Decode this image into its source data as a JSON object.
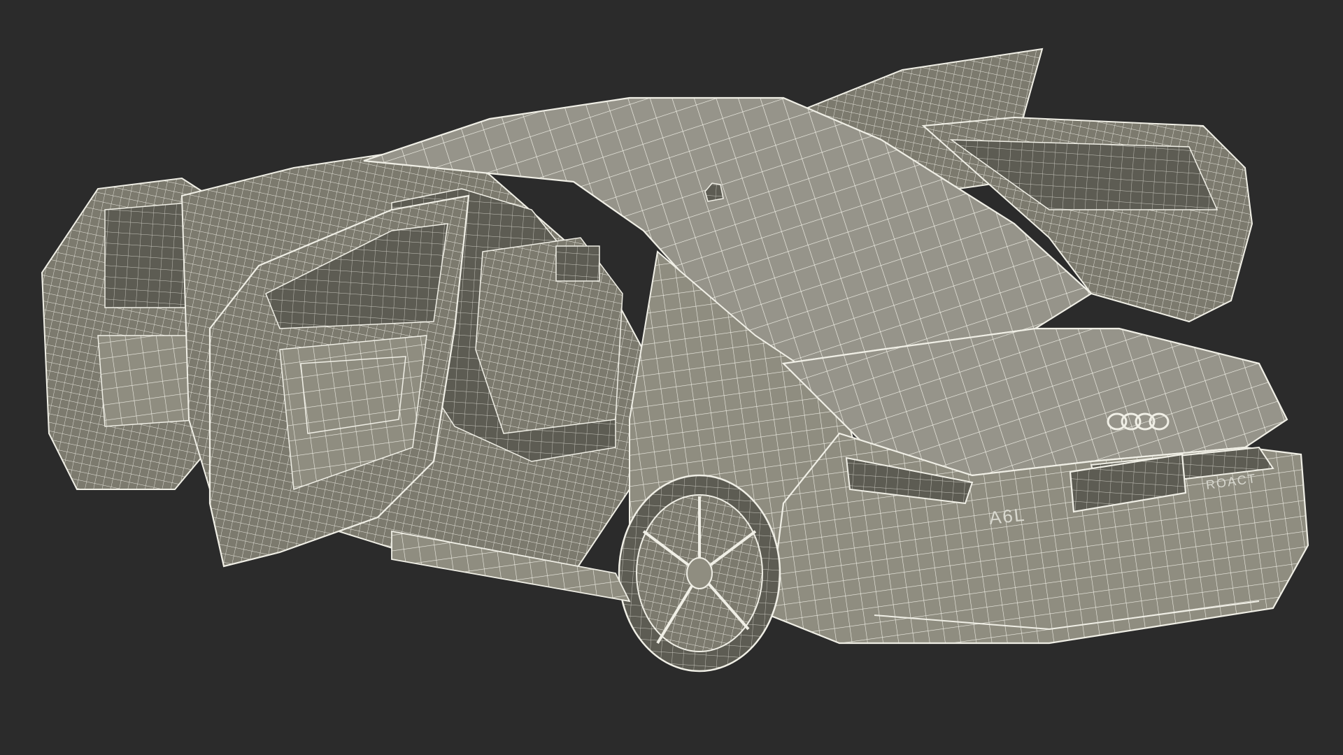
{
  "scene": {
    "background": "#2b2b2b",
    "mesh_color": "#efeee6",
    "surface_color": "#8f8d80",
    "shadow_color": "#5c5b52",
    "subject": "car-wireframe-render"
  },
  "badges": {
    "model": "A6L",
    "trunk_script": "ROACT"
  }
}
